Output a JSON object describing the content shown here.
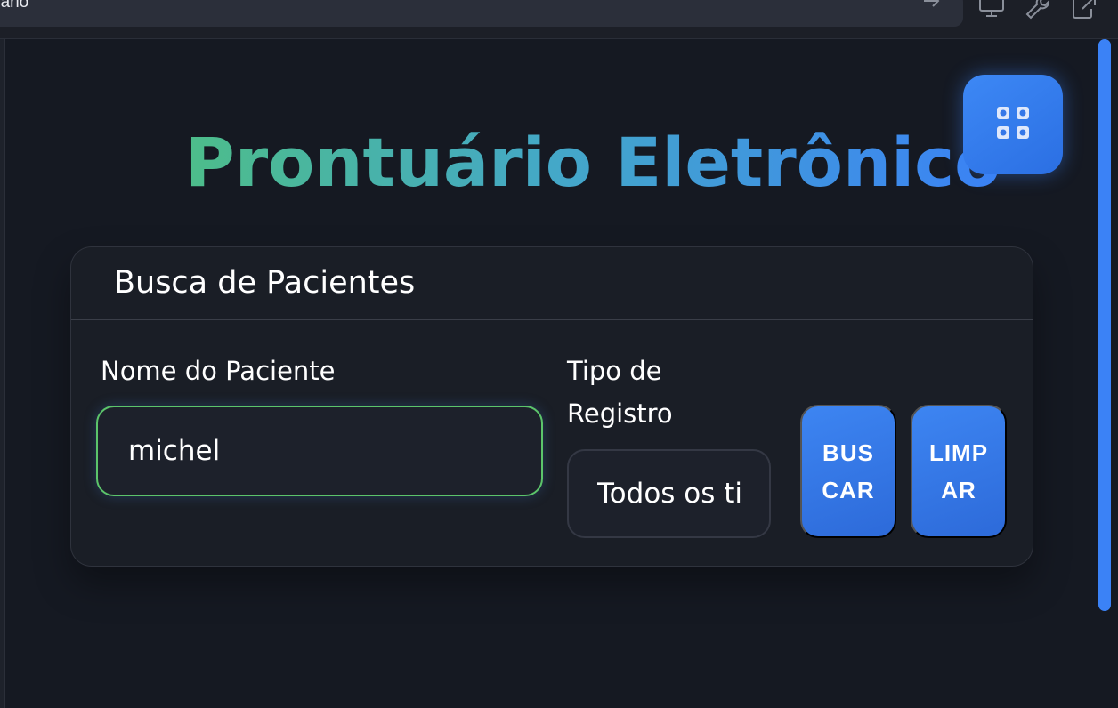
{
  "browser": {
    "url_text": "uario",
    "icons": [
      "arrow-right-icon",
      "monitor-icon",
      "wrench-icon",
      "external-link-icon"
    ]
  },
  "page": {
    "title": "Prontuário Eletrônico",
    "grid_button_icon": "grid-icon"
  },
  "search_card": {
    "title": "Busca de Pacientes",
    "name_label": "Nome do Paciente",
    "name_value": "michel",
    "type_label": "Tipo de Registro",
    "type_selected": "Todos os tipos",
    "search_button": "BUSCAR",
    "clear_button": "LIMPAR"
  },
  "colors": {
    "accent": "#3b82f6",
    "title_gradient_start": "#4dbd8a",
    "focus_border": "#5cc46a",
    "background": "#151922",
    "card": "#1a1e26"
  }
}
